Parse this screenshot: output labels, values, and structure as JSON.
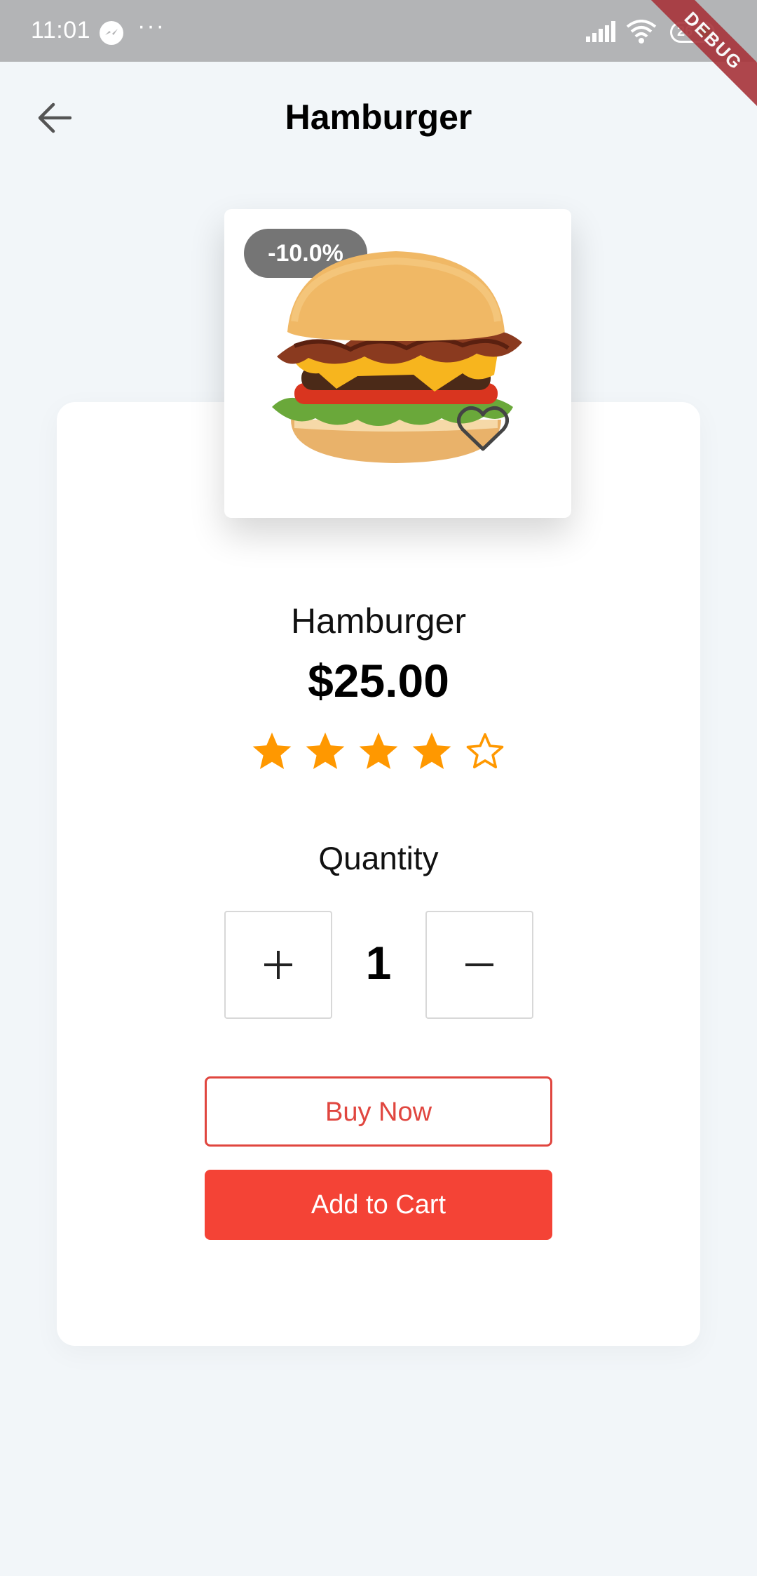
{
  "status_bar": {
    "time": "11:01",
    "more": "···",
    "battery": "26",
    "debug_banner": "DEBUG"
  },
  "header": {
    "title": "Hamburger"
  },
  "product": {
    "discount": "-10.0%",
    "name": "Hamburger",
    "price": "$25.00",
    "rating": 4,
    "rating_max": 5,
    "star_color": "#ff9800",
    "favorite": false
  },
  "quantity": {
    "label": "Quantity",
    "value": "1",
    "plus_symbol": "+",
    "minus_symbol": "−"
  },
  "actions": {
    "buy_now": "Buy Now",
    "add_to_cart": "Add to Cart"
  },
  "colors": {
    "accent": "#f44336",
    "accent_border": "#e0463f",
    "background": "#f2f6f9"
  }
}
